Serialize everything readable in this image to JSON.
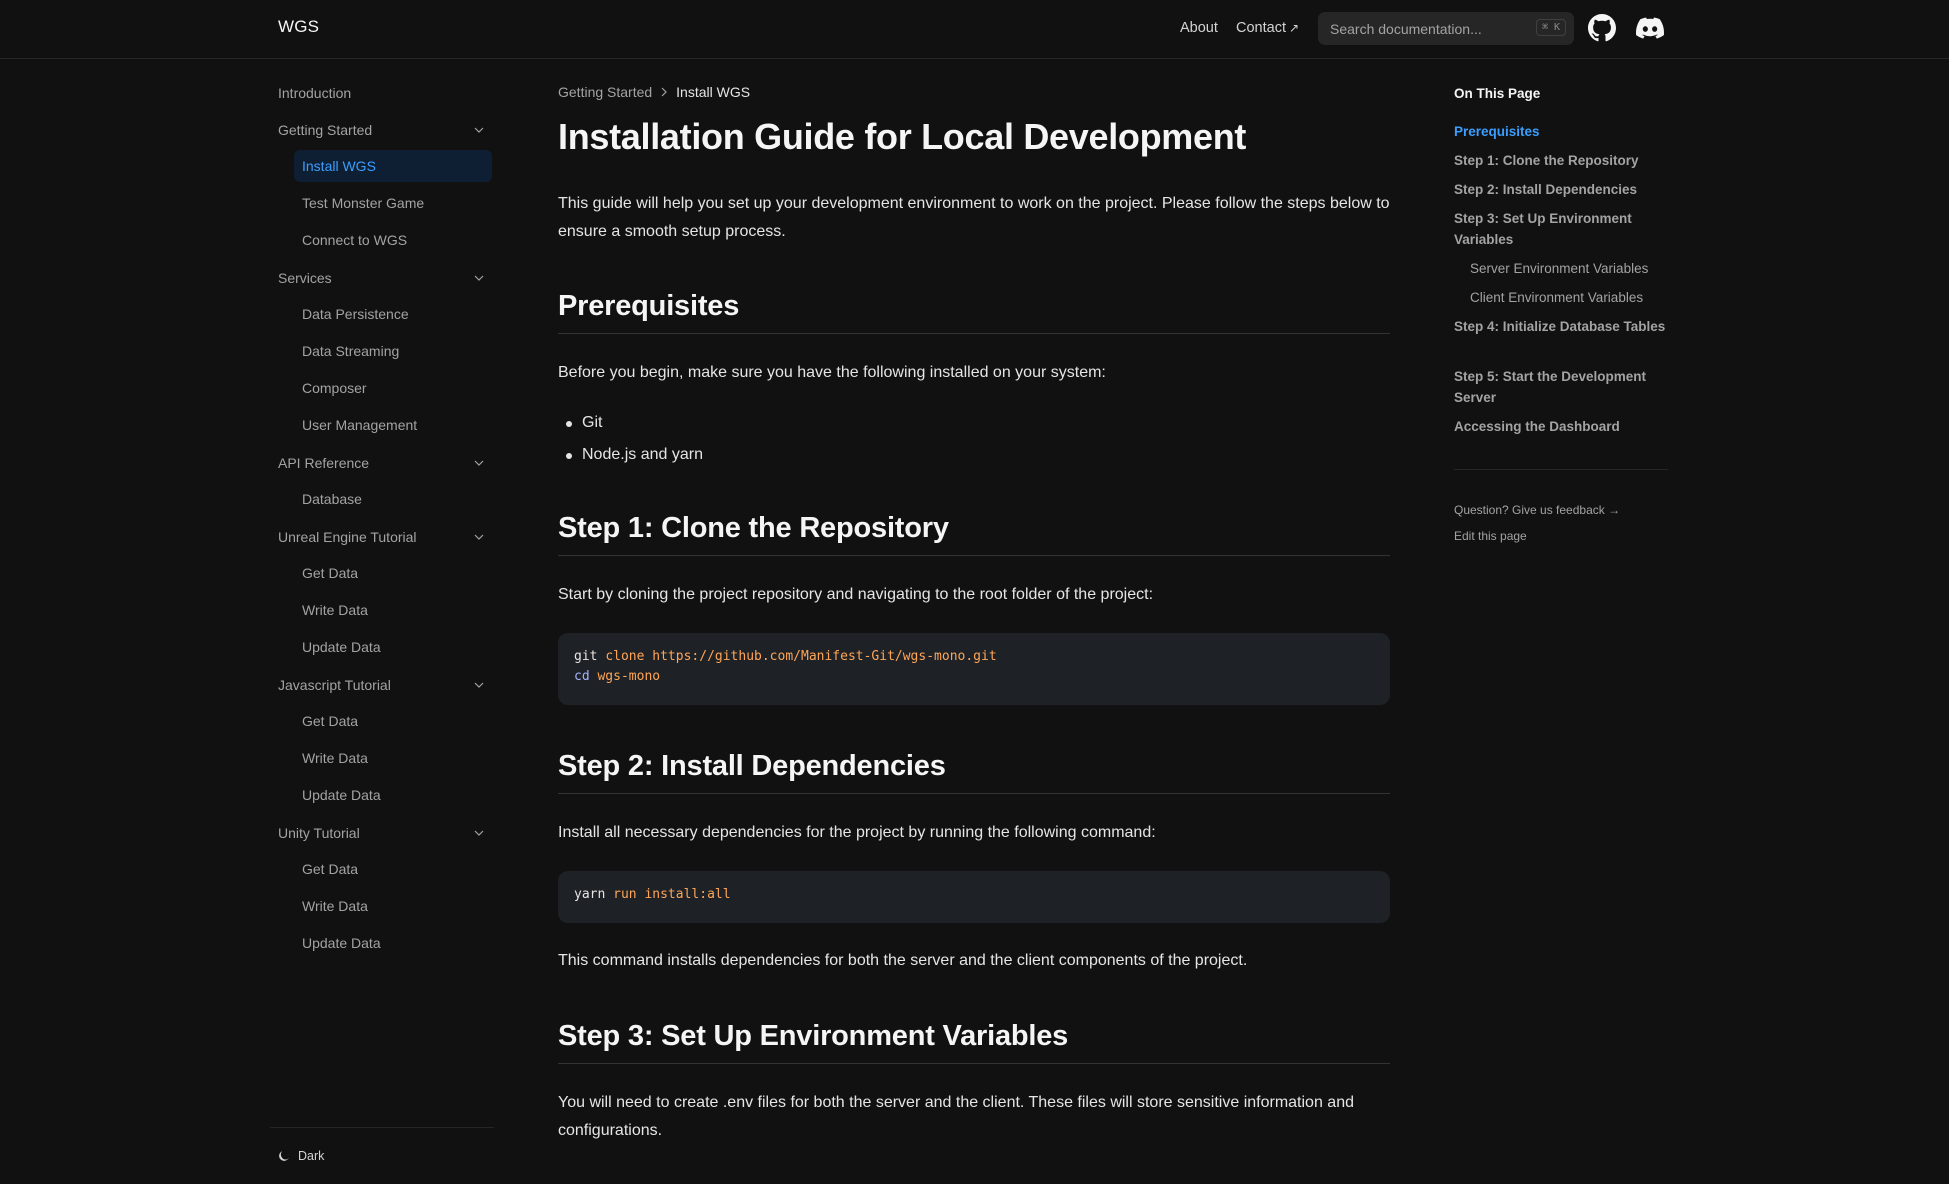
{
  "header": {
    "logo": "WGS",
    "nav": {
      "about": "About",
      "contact": "Contact",
      "contact_arrow": "↗"
    },
    "search": {
      "placeholder": "Search documentation...",
      "shortcut": "⌘ K"
    }
  },
  "sidebar": {
    "intro": "Introduction",
    "groups": [
      {
        "label": "Getting Started",
        "items": [
          "Install WGS",
          "Test Monster Game",
          "Connect to WGS"
        ]
      },
      {
        "label": "Services",
        "items": [
          "Data Persistence",
          "Data Streaming",
          "Composer",
          "User Management"
        ]
      },
      {
        "label": "API Reference",
        "items": [
          "Database"
        ]
      },
      {
        "label": "Unreal Engine Tutorial",
        "items": [
          "Get Data",
          "Write Data",
          "Update Data"
        ]
      },
      {
        "label": "Javascript Tutorial",
        "items": [
          "Get Data",
          "Write Data",
          "Update Data"
        ]
      },
      {
        "label": "Unity Tutorial",
        "items": [
          "Get Data",
          "Write Data",
          "Update Data"
        ]
      }
    ],
    "theme_label": "Dark"
  },
  "main": {
    "breadcrumb": {
      "parent": "Getting Started",
      "current": "Install WGS"
    },
    "title": "Installation Guide for Local Development",
    "intro": "This guide will help you set up your development environment to work on the project. Please follow the steps below to ensure a smooth setup process.",
    "prereq_heading": "Prerequisites",
    "prereq_text": "Before you begin, make sure you have the following installed on your system:",
    "prereq_items": [
      "Git",
      "Node.js and yarn"
    ],
    "step1_heading": "Step 1: Clone the Repository",
    "step1_text": "Start by cloning the project repository and navigating to the root folder of the project:",
    "step1_code": {
      "l1_cmd": "git",
      "l1_sub": "clone",
      "l1_arg": "https://github.com/Manifest-Git/wgs-mono.git",
      "l2_cmd": "cd",
      "l2_arg": "wgs-mono"
    },
    "step2_heading": "Step 2: Install Dependencies",
    "step2_text": "Install all necessary dependencies for the project by running the following command:",
    "step2_code": {
      "cmd": "yarn",
      "sub": "run",
      "arg": "install:all"
    },
    "step2_note": "This command installs dependencies for both the server and the client components of the project.",
    "step3_heading": "Step 3: Set Up Environment Variables",
    "step3_text": "You will need to create .env files for both the server and the client. These files will store sensitive information and configurations."
  },
  "toc": {
    "title": "On This Page",
    "links": [
      "Prerequisites",
      "Step 1: Clone the Repository",
      "Step 2: Install Dependencies",
      "Step 3: Set Up Environment Variables",
      "Server Environment Variables",
      "Client Environment Variables",
      "Step 4: Initialize Database Tables",
      "Step 5: Start the Development Server",
      "Accessing the Dashboard"
    ],
    "feedback": "Question? Give us feedback →",
    "edit": "Edit this page"
  },
  "colors": {
    "background": "#111111",
    "accent": "#3b9eff",
    "code_bg": "#1e2126",
    "code_keyword": "#ffa657"
  }
}
